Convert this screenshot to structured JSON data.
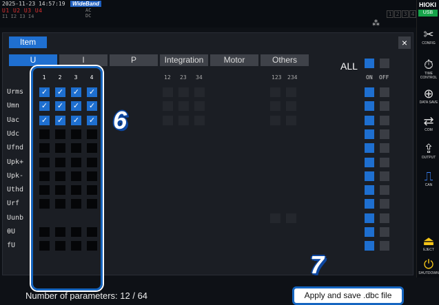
{
  "status": {
    "timestamp": "2025-11-23 14:57:19",
    "mode_badge": "WideBand",
    "channels_red": "U1 U2 U3 U4",
    "channels_gray": "I1 I2 I3 I4",
    "ac_lines": [
      "AC",
      "DC"
    ],
    "ch_numbers": [
      "1",
      "2",
      "3",
      "4"
    ],
    "lan_icon": "network-icon"
  },
  "sidebar": {
    "brand": "HIOKI",
    "usb": "USB",
    "items": [
      {
        "label": "CONFIG",
        "icon": "wrench-icon",
        "glyph": "✂"
      },
      {
        "label": "TIME CONTROL",
        "icon": "timer-icon",
        "glyph": "⏱"
      },
      {
        "label": "DATA SAVE",
        "icon": "save-icon",
        "glyph": "⊕"
      },
      {
        "label": "COM",
        "icon": "com-icon",
        "glyph": "⇄"
      },
      {
        "label": "OUTPUT",
        "icon": "output-icon",
        "glyph": "⇪"
      },
      {
        "label": "CAN",
        "icon": "can-icon",
        "glyph": "⎍"
      },
      {
        "label": "EJECT",
        "icon": "eject-icon",
        "glyph": "⏏"
      },
      {
        "label": "SHUTDOWN",
        "icon": "power-icon",
        "glyph": "⏻"
      }
    ]
  },
  "dialog": {
    "item_tab": "Item",
    "close": "×",
    "tabs": [
      "U",
      "I",
      "P",
      "Integration",
      "Motor",
      "Others"
    ],
    "all_label": "ALL",
    "on_label": "ON",
    "off_label": "OFF",
    "channel_headers": [
      "1",
      "2",
      "3",
      "4"
    ],
    "integration_headers": [
      "12",
      "23",
      "34"
    ],
    "others_headers": [
      "123",
      "234"
    ],
    "rows": [
      {
        "label": "Urms",
        "checks": [
          true,
          true,
          true,
          true
        ]
      },
      {
        "label": "Umn",
        "checks": [
          true,
          true,
          true,
          true
        ]
      },
      {
        "label": "Uac",
        "checks": [
          true,
          true,
          true,
          true
        ]
      },
      {
        "label": "Udc",
        "checks": [
          false,
          false,
          false,
          false
        ]
      },
      {
        "label": "Ufnd",
        "checks": [
          false,
          false,
          false,
          false
        ]
      },
      {
        "label": "Upk+",
        "checks": [
          false,
          false,
          false,
          false
        ]
      },
      {
        "label": "Upk-",
        "checks": [
          false,
          false,
          false,
          false
        ]
      },
      {
        "label": "Uthd",
        "checks": [
          false,
          false,
          false,
          false
        ]
      },
      {
        "label": "Urf",
        "checks": [
          false,
          false,
          false,
          false
        ]
      },
      {
        "label": "Uunb",
        "checks": null
      },
      {
        "label": "θU",
        "checks": [
          false,
          false,
          false,
          false
        ]
      },
      {
        "label": "fU",
        "checks": [
          false,
          false,
          false,
          false
        ]
      }
    ],
    "params_text": "Number of parameters: 12 / 64",
    "apply_button": "Apply and save .dbc file",
    "callout_6": "6",
    "callout_7": "7"
  }
}
